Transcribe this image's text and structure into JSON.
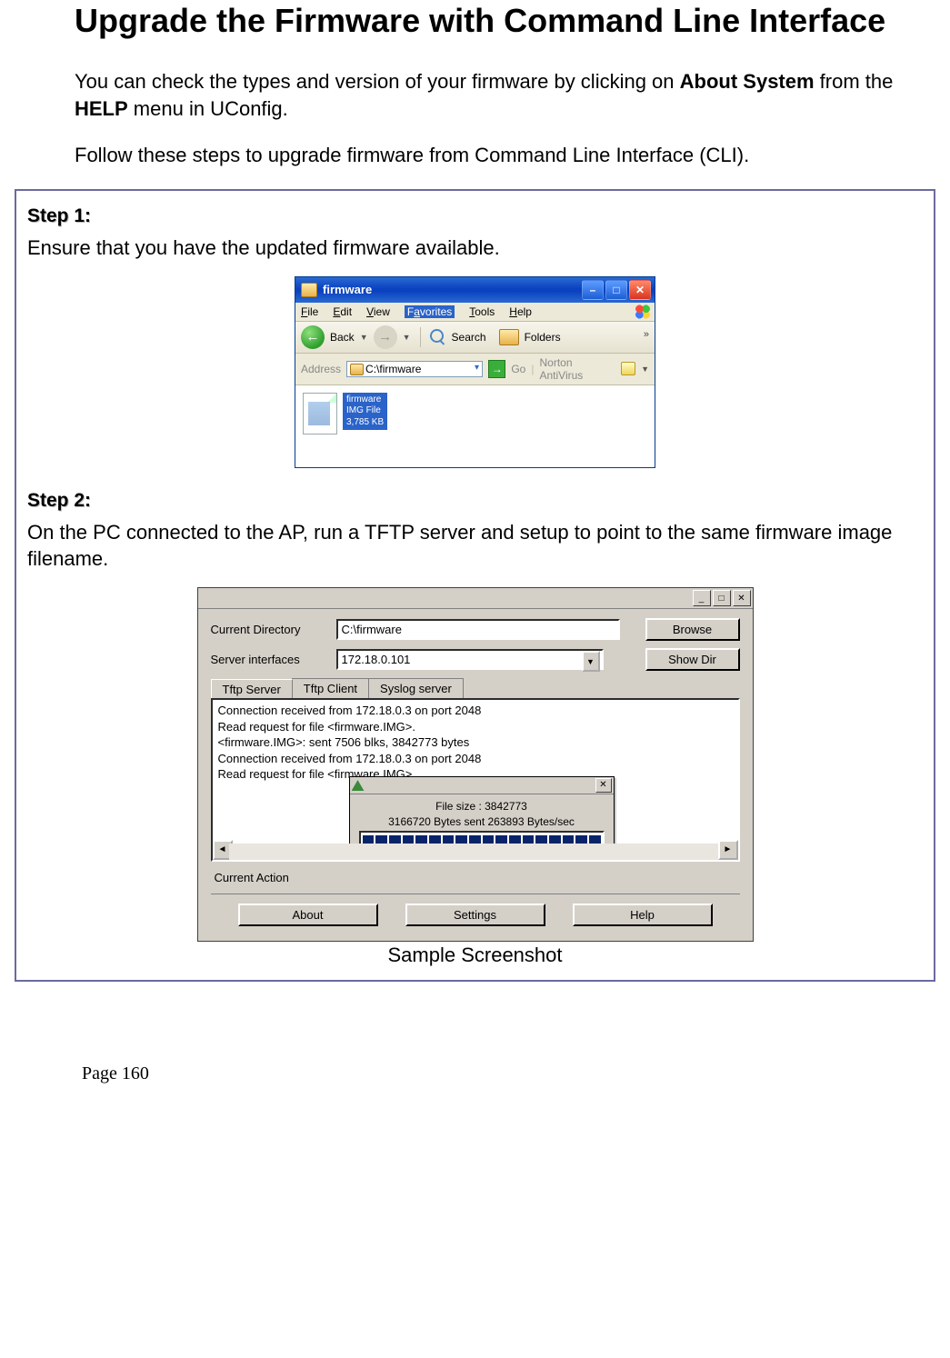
{
  "title": "Upgrade the Firmware with Command Line Interface",
  "intro": {
    "p1_a": "You can check the types and version of your firmware by clicking on ",
    "about": "About System",
    "p1_b": " from the ",
    "help": "HELP",
    "p1_c": " menu in UConfig.",
    "p2": "Follow these steps to upgrade firmware from Command Line Interface (CLI)."
  },
  "step1": {
    "label": "Step 1:",
    "text": "Ensure that you have the updated firmware available."
  },
  "explorer": {
    "title": "firmware",
    "menus": {
      "file": "File",
      "edit": "Edit",
      "view": "View",
      "fav": "Favorites",
      "tools": "Tools",
      "help": "Help"
    },
    "tb": {
      "back": "Back",
      "search": "Search",
      "folders": "Folders"
    },
    "address_label": "Address",
    "address_value": "C:\\firmware",
    "go": "Go",
    "nav": "Norton AntiVirus",
    "file": {
      "name": "firmware",
      "type": "IMG File",
      "size": "3,785 KB"
    }
  },
  "step2": {
    "label": "Step 2:",
    "text": "On the PC connected to the AP, run a TFTP server and setup to point to the same firmware image filename."
  },
  "tftp": {
    "cd_label": "Current Directory",
    "cd_value": "C:\\firmware",
    "browse": "Browse",
    "si_label": "Server interfaces",
    "si_value": "172.18.0.101",
    "showdir": "Show Dir",
    "tabs": {
      "server": "Tftp Server",
      "client": "Tftp Client",
      "syslog": "Syslog server"
    },
    "log": [
      "Connection received from 172.18.0.3 on port 2048",
      "Read request for file <firmware.IMG>.",
      "<firmware.IMG>: sent 7506 blks, 3842773 bytes",
      "Connection received from 172.18.0.3 on port 2048",
      "Read request for file <firmware.IMG>."
    ],
    "progress": {
      "l1": "File size : 3842773",
      "l2": "3166720 Bytes sent   263893 Bytes/sec"
    },
    "current_action": "Current Action",
    "about": "About",
    "settings": "Settings",
    "helpbtn": "Help"
  },
  "caption": "Sample Screenshot",
  "pagenum": "Page 160"
}
